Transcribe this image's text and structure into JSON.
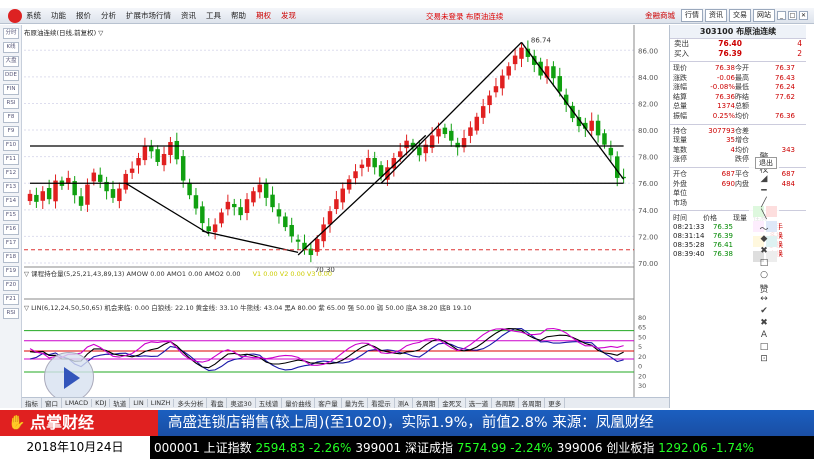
{
  "topbar": {
    "menu": [
      "系统",
      "功能",
      "报价",
      "分析",
      "扩展市场行情",
      "资讯",
      "工具",
      "帮助",
      "期权",
      "发现"
    ],
    "status": "交易未登录  布原油连续",
    "brand": "金融商城",
    "buttons": [
      "行情",
      "资讯",
      "交易",
      "网站"
    ]
  },
  "leftbar": [
    "分时",
    "K线",
    "大盘",
    "DDE",
    "FIN",
    "RSI",
    "F8",
    "F9",
    "F10",
    "F11",
    "F12",
    "F13",
    "F14",
    "F15",
    "F16",
    "F17",
    "F18",
    "F19",
    "F20",
    "F21",
    "RSI"
  ],
  "chart": {
    "title": "布原油连续(日线,前复权) ▽",
    "price_ticks": [
      "86.00",
      "84.00",
      "82.00",
      "80.00",
      "78.00",
      "76.00",
      "74.00",
      "72.00",
      "70.00"
    ],
    "high_label": "86.74",
    "low_label": "70.30",
    "volume_legend": "▽ 课程持仓量(5,25,21,43,89,13)  AMOW 0.00  AMO1 0.00  AMO2 0.00",
    "volume_legend_extra": "V1 0.00   V2 0.00   V3 0.00",
    "indicator_legend": "▽ LIN(6,12,24,50,50,65)  机会来临: 0.00  白狼线: 22.10  黄金线: 33.10  牛熊线: 43.04  黑A 80.00  紫 65.00  强 50.00  弱 50.00  底A 38.20  底B 19.10",
    "indicator_ticks": [
      "80",
      "65",
      "50",
      "5",
      "20",
      "0",
      "20",
      "30"
    ]
  },
  "chart_data": [
    {
      "type": "candlestick",
      "title": "布原油连续(日线,前复权)",
      "ylim": [
        70,
        87
      ],
      "high": 86.74,
      "low": 70.3,
      "closes": [
        75.2,
        74.6,
        75.4,
        74.8,
        76.2,
        75.8,
        76.4,
        75.1,
        74.3,
        75.9,
        76.8,
        76.1,
        75.4,
        74.9,
        75.6,
        76.7,
        77.1,
        77.9,
        78.8,
        78.4,
        77.6,
        78.2,
        79.1,
        77.8,
        76.2,
        75.1,
        74.1,
        73.0,
        72.4,
        72.9,
        73.8,
        74.6,
        74.2,
        73.6,
        74.8,
        75.4,
        75.9,
        74.9,
        74.2,
        73.5,
        72.7,
        72.0,
        71.6,
        71.0,
        70.6,
        71.8,
        72.9,
        73.9,
        74.8,
        75.6,
        76.3,
        76.9,
        77.4,
        77.9,
        77.2,
        76.5,
        77.2,
        77.9,
        78.4,
        79.2,
        78.7,
        78.1,
        78.9,
        79.6,
        80.1,
        79.7,
        79.2,
        78.7,
        79.4,
        80.2,
        81.0,
        81.8,
        82.6,
        83.3,
        84.1,
        84.8,
        85.6,
        86.2,
        85.5,
        84.9,
        84.1,
        84.8,
        83.9,
        82.9,
        81.9,
        80.9,
        80.3,
        80.1,
        80.7,
        79.6,
        78.9,
        78.1,
        76.4,
        76.38
      ]
    },
    {
      "type": "line",
      "title": "LIN(6,12,24,50,50,65)",
      "levels": [
        80,
        65,
        50,
        38.2,
        19.1
      ]
    }
  ],
  "tabs": [
    "指标",
    "窗口",
    "LMACD",
    "KDJ",
    "轨道",
    "LIN",
    "LINZH",
    "多头分析",
    "看盘",
    "奥运30",
    "五线谱",
    "量价曲线",
    "客户量",
    "量为先",
    "看提示",
    "测A",
    "各周期",
    "金死叉",
    "选一道",
    "各周期",
    "各周期",
    "更多"
  ],
  "quote": {
    "code": "303100 布原油连续",
    "sell": {
      "label": "卖出",
      "price": "76.40",
      "vol": "4"
    },
    "buy": {
      "label": "买入",
      "price": "76.39",
      "vol": "2"
    },
    "rows": [
      [
        "现价",
        "76.38",
        "今开",
        "76.37"
      ],
      [
        "涨跌",
        "-0.06",
        "最高",
        "76.43"
      ],
      [
        "涨幅",
        "-0.08%",
        "最低",
        "76.24"
      ],
      [
        "结算",
        "76.36",
        "昨结",
        "77.62"
      ],
      [
        "总量",
        "1374",
        "总额",
        ""
      ],
      [
        "振幅",
        "0.25%",
        "均价",
        "76.36"
      ]
    ],
    "rows2": [
      [
        "持仓",
        "307793",
        "仓差",
        ""
      ],
      [
        "现量",
        "35",
        "增仓",
        ""
      ],
      [
        "笔数",
        "4",
        "均价",
        "343"
      ],
      [
        "涨停",
        "",
        "跌停",
        ""
      ]
    ],
    "rows3": [
      [
        "开仓",
        "687",
        "平仓",
        "687"
      ],
      [
        "外盘",
        "690",
        "内盘",
        "484"
      ],
      [
        "单位",
        "",
        "",
        ""
      ],
      [
        "市场",
        "",
        "",
        ""
      ]
    ],
    "trade_head": [
      "时间",
      "价格",
      "现量",
      "性质"
    ],
    "trades": [
      [
        "08:21:33",
        "76.35",
        "",
        "换手"
      ],
      [
        "08:31:14",
        "76.39",
        "",
        "多换"
      ],
      [
        "08:35:28",
        "76.41",
        "",
        "多换"
      ],
      [
        "08:39:40",
        "76.38",
        "",
        "空换"
      ]
    ]
  },
  "toolbox": {
    "exit": "退出",
    "tools": [
      "警",
      "校",
      "◢",
      "━",
      "╱",
      "╲",
      "〜",
      "◆",
      "✖",
      "□",
      "○",
      "赞",
      "↔",
      "✔",
      "✖",
      "A",
      "□",
      "⊡"
    ]
  },
  "palette_colors": [
    "#2c2",
    "#e22",
    "#e8e",
    "#26c",
    "#fc2",
    "#2aa",
    "#222",
    "#888"
  ],
  "banner": {
    "logo": "点掌财经",
    "news": "高盛连锁店销售(较上周)(至1020)，实际1.9%，前值2.8% 来源：凤凰财经"
  },
  "ticker": {
    "date": "2018年10月24日",
    "items": [
      {
        "code": "000001",
        "name": "上证指数",
        "price": "2594.83",
        "chg": "-2.26%"
      },
      {
        "code": "399001",
        "name": "深证成指",
        "price": "7574.99",
        "chg": "-2.24%"
      },
      {
        "code": "399006",
        "name": "创业板指",
        "price": "1292.06",
        "chg": "-1.74%"
      }
    ]
  },
  "colors": {
    "up": "#e02020",
    "down": "#10a010",
    "banner": "#1b5fc0"
  }
}
